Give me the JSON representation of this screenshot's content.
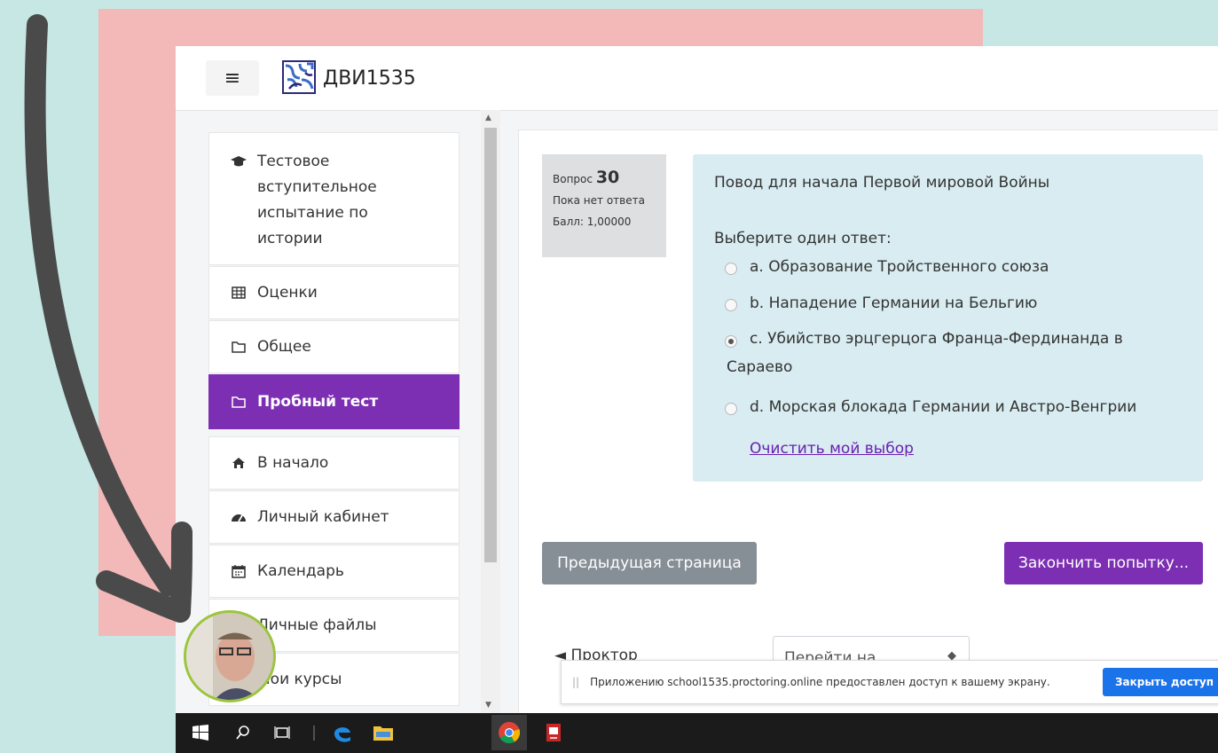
{
  "navbar": {
    "brand": "ДВИ1535",
    "menu_icon": "hamburger-icon",
    "logo_icon": "site-logo"
  },
  "sidebar": {
    "items": [
      {
        "label": "Тестовое вступительное испытание по истории",
        "icon": "graduation-cap-icon",
        "active": false
      },
      {
        "label": "Оценки",
        "icon": "table-icon",
        "active": false
      },
      {
        "label": "Общее",
        "icon": "folder-icon",
        "active": false
      },
      {
        "label": "Пробный тест",
        "icon": "folder-icon",
        "active": true
      },
      {
        "label": "В начало",
        "icon": "home-icon",
        "active": false
      },
      {
        "label": "Личный кабинет",
        "icon": "dashboard-icon",
        "active": false
      },
      {
        "label": "Календарь",
        "icon": "calendar-icon",
        "active": false
      },
      {
        "label": "Личные файлы",
        "icon": "file-icon",
        "active": false
      },
      {
        "label": "Мои курсы",
        "icon": "courses-icon",
        "active": false
      }
    ]
  },
  "question": {
    "label": "Вопрос",
    "number": "30",
    "status": "Пока нет ответа",
    "score": "Балл: 1,00000",
    "text": "Повод для начала Первой мировой Войны",
    "prompt": "Выберите один ответ:",
    "options": [
      {
        "label": "a. Образование Тройственного союза",
        "checked": false
      },
      {
        "label": "b. Нападение Германии на Бельгию",
        "checked": false
      },
      {
        "label": "c. Убийство эрцгерцога Франца-Фердинанда в",
        "label_cont": "Сараево",
        "checked": true
      },
      {
        "label": "d. Морская блокада Германии и Австро-Венгрии",
        "checked": false
      }
    ],
    "clear_link": "Очистить мой выбор"
  },
  "nav_buttons": {
    "prev": "Предыдущая страница",
    "finish": "Закончить попытку..."
  },
  "footer": {
    "link": "◄ Проктор",
    "select_value": "Перейти на..."
  },
  "share_bar": {
    "message": "Приложению school1535.proctoring.online предоставлен доступ к вашему экрану.",
    "button": "Закрыть доступ"
  },
  "colors": {
    "accent": "#7c2fb3",
    "question_bg": "#d8ecf1",
    "share_button": "#1a73e8"
  }
}
